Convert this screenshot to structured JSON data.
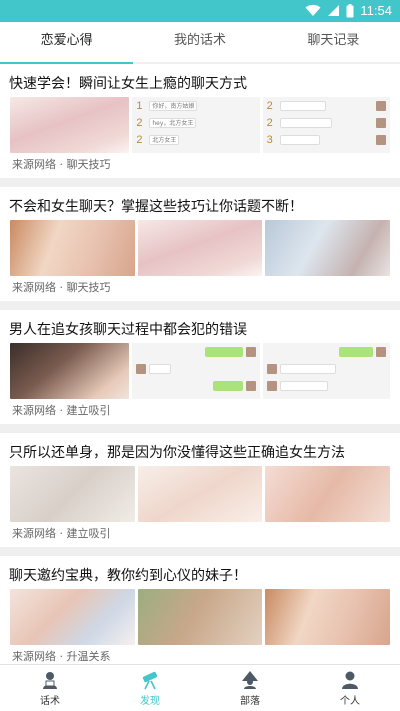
{
  "status_bar": {
    "time": "11:54"
  },
  "tabs": [
    {
      "label": "恋爱心得",
      "active": true
    },
    {
      "label": "我的话术",
      "active": false
    },
    {
      "label": "聊天记录",
      "active": false
    }
  ],
  "articles": [
    {
      "title": "快速学会！瞬间让女生上瘾的聊天方式",
      "meta": "来源网络 · 聊天技巧",
      "chat_lines": [
        {
          "num": "1",
          "left": "你好，南方姑娘"
        },
        {
          "num": "2",
          "left": "hey，北方女王"
        },
        {
          "num": "2",
          "left": "北方女王"
        }
      ]
    },
    {
      "title": "不会和女生聊天？掌握这些技巧让你话题不断！",
      "meta": "来源网络 · 聊天技巧"
    },
    {
      "title": "男人在追女孩聊天过程中都会犯的错误",
      "meta": "来源网络 · 建立吸引"
    },
    {
      "title": "只所以还单身，那是因为你没懂得这些正确追女生方法",
      "meta": "来源网络 · 建立吸引"
    },
    {
      "title": "聊天邀约宝典，教你约到心仪的妹子！",
      "meta": "来源网络 · 升温关系"
    }
  ],
  "bottom_nav": [
    {
      "label": "话术",
      "icon": "person-board-icon",
      "active": false
    },
    {
      "label": "发现",
      "icon": "telescope-icon",
      "active": true
    },
    {
      "label": "部落",
      "icon": "tribe-icon",
      "active": false
    },
    {
      "label": "个人",
      "icon": "user-icon",
      "active": false
    }
  ],
  "colors": {
    "accent": "#43c6c9",
    "active_text": "#43c6c9"
  }
}
